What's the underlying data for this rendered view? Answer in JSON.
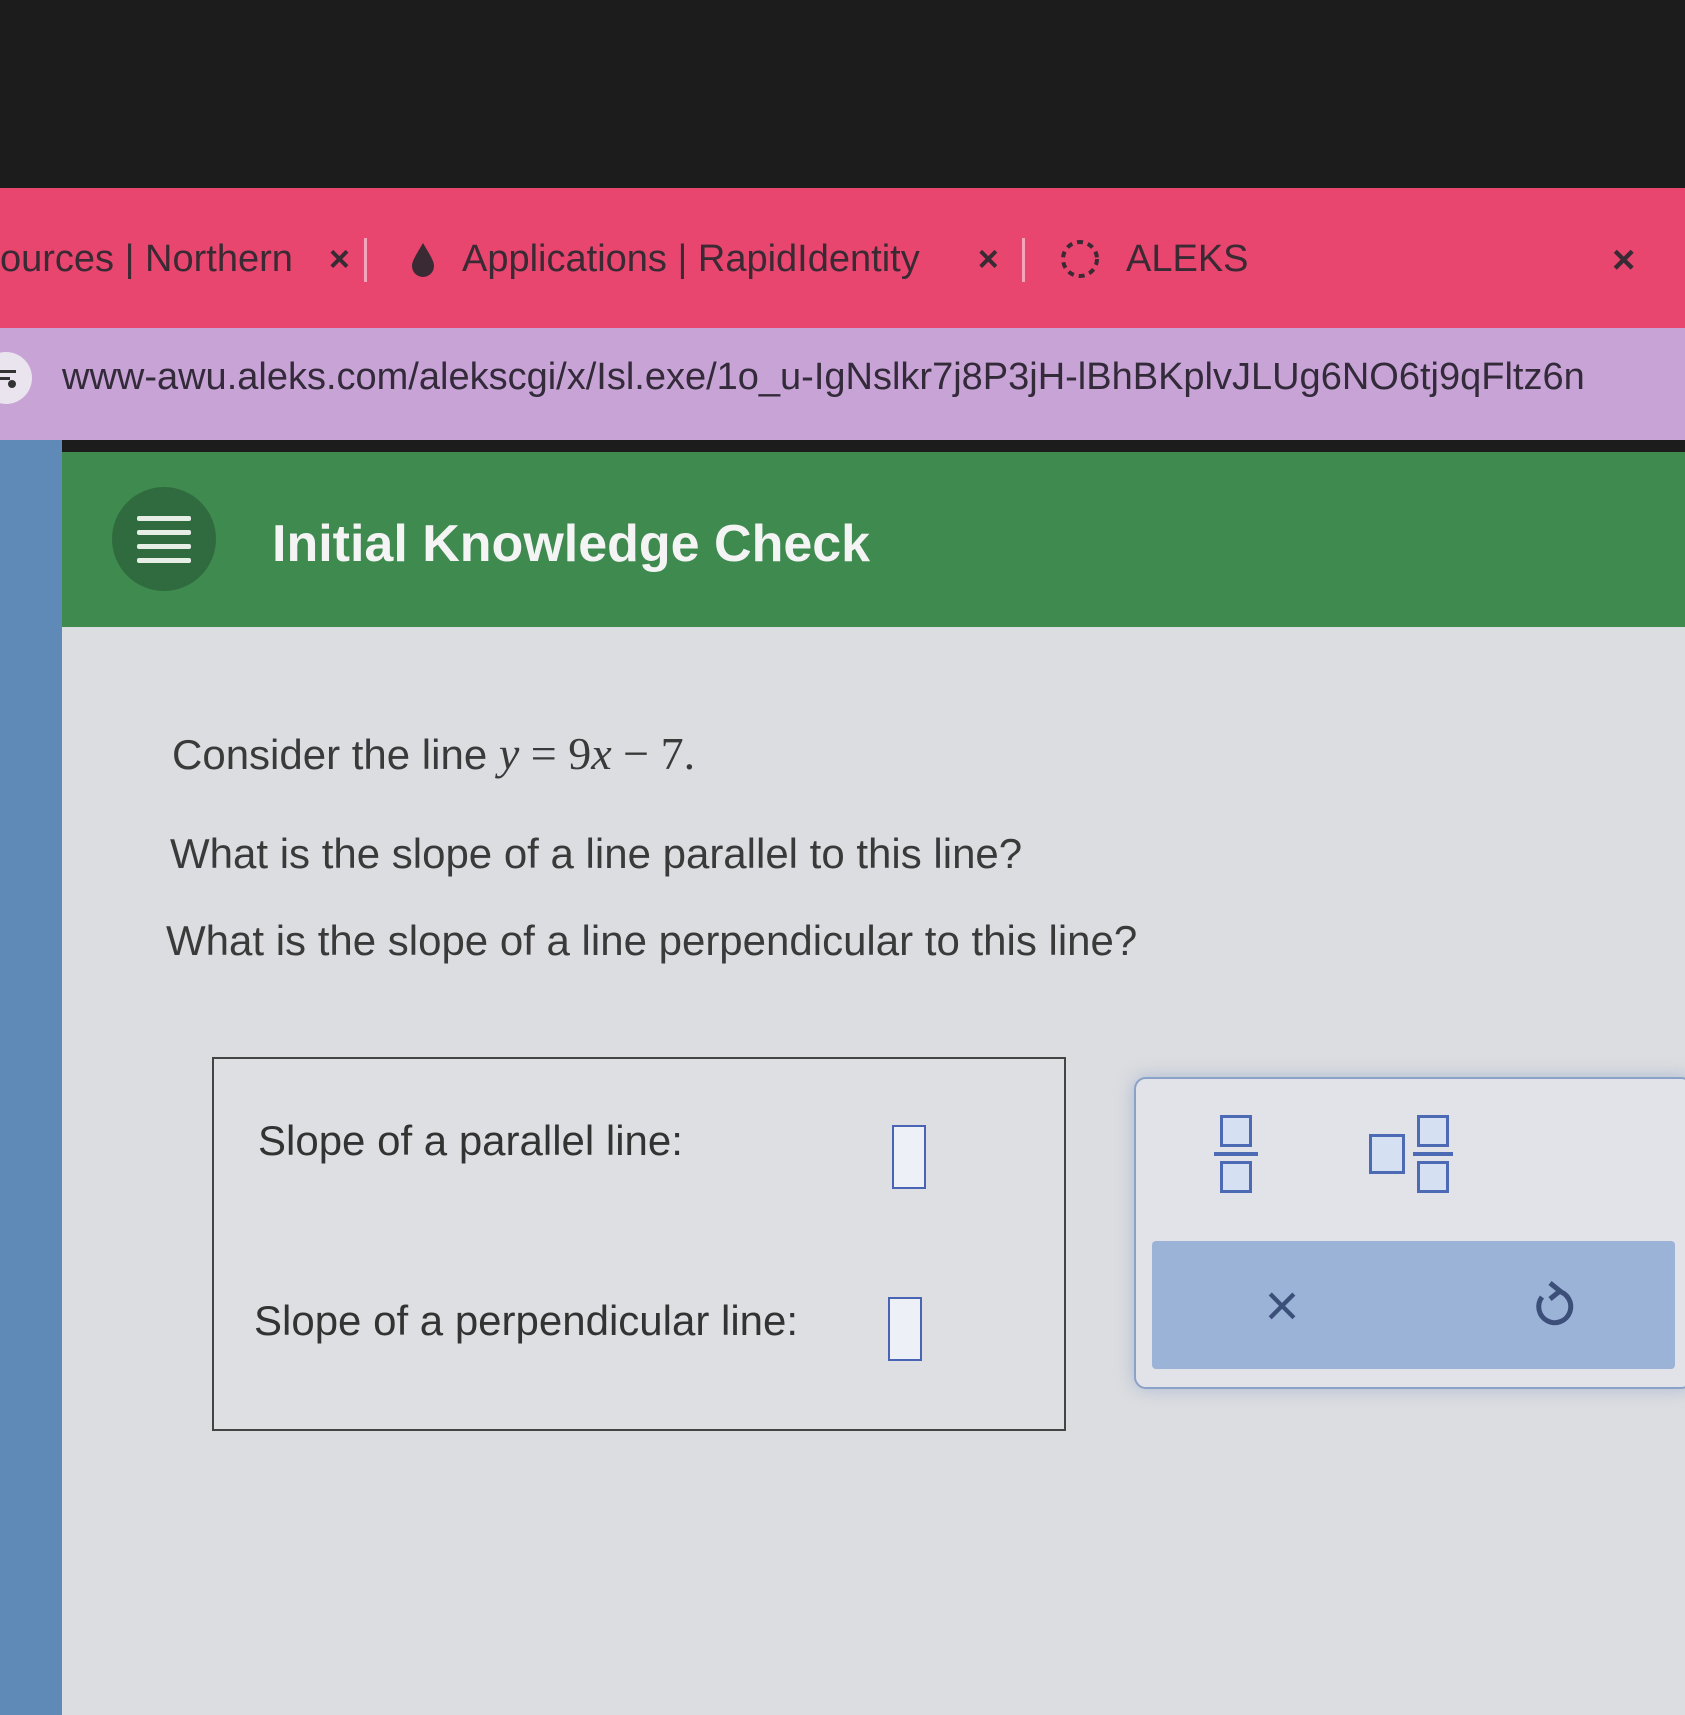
{
  "tabs": [
    {
      "label": "ources | Northern",
      "close": "×"
    },
    {
      "label": "Applications | RapidIdentity",
      "close": "×"
    },
    {
      "label": "ALEKS",
      "close": "×"
    }
  ],
  "address_bar": {
    "url": "www-awu.aleks.com/alekscgi/x/Isl.exe/1o_u-IgNslkr7j8P3jH-lBhBKplvJLUg6NO6tj9qFltz6n"
  },
  "header": {
    "title": "Initial Knowledge Check",
    "menu_icon": "hamburger-icon"
  },
  "question": {
    "intro": "Consider the line ",
    "equation": {
      "y": "y",
      "eq": " = ",
      "coef": "9",
      "x": "x",
      "rest": " − 7",
      "period": "."
    },
    "q1": "What is the slope of a line parallel to this line?",
    "q2": "What is the slope of a line perpendicular to this line?"
  },
  "answers": {
    "parallel_label": "Slope of a parallel line:",
    "parallel_value": "",
    "perpendicular_label": "Slope of a perpendicular line:",
    "perpendicular_value": ""
  },
  "palette": {
    "fraction_icon": "fraction-icon",
    "mixed_number_icon": "mixed-number-icon",
    "clear": "×",
    "undo_icon": "undo-icon"
  },
  "colors": {
    "tab_bar": "#e8456f",
    "address_bar": "#c7a3d6",
    "header": "#3f8a4f",
    "input_border": "#4a64b5",
    "palette_action": "#9cb3d8"
  }
}
